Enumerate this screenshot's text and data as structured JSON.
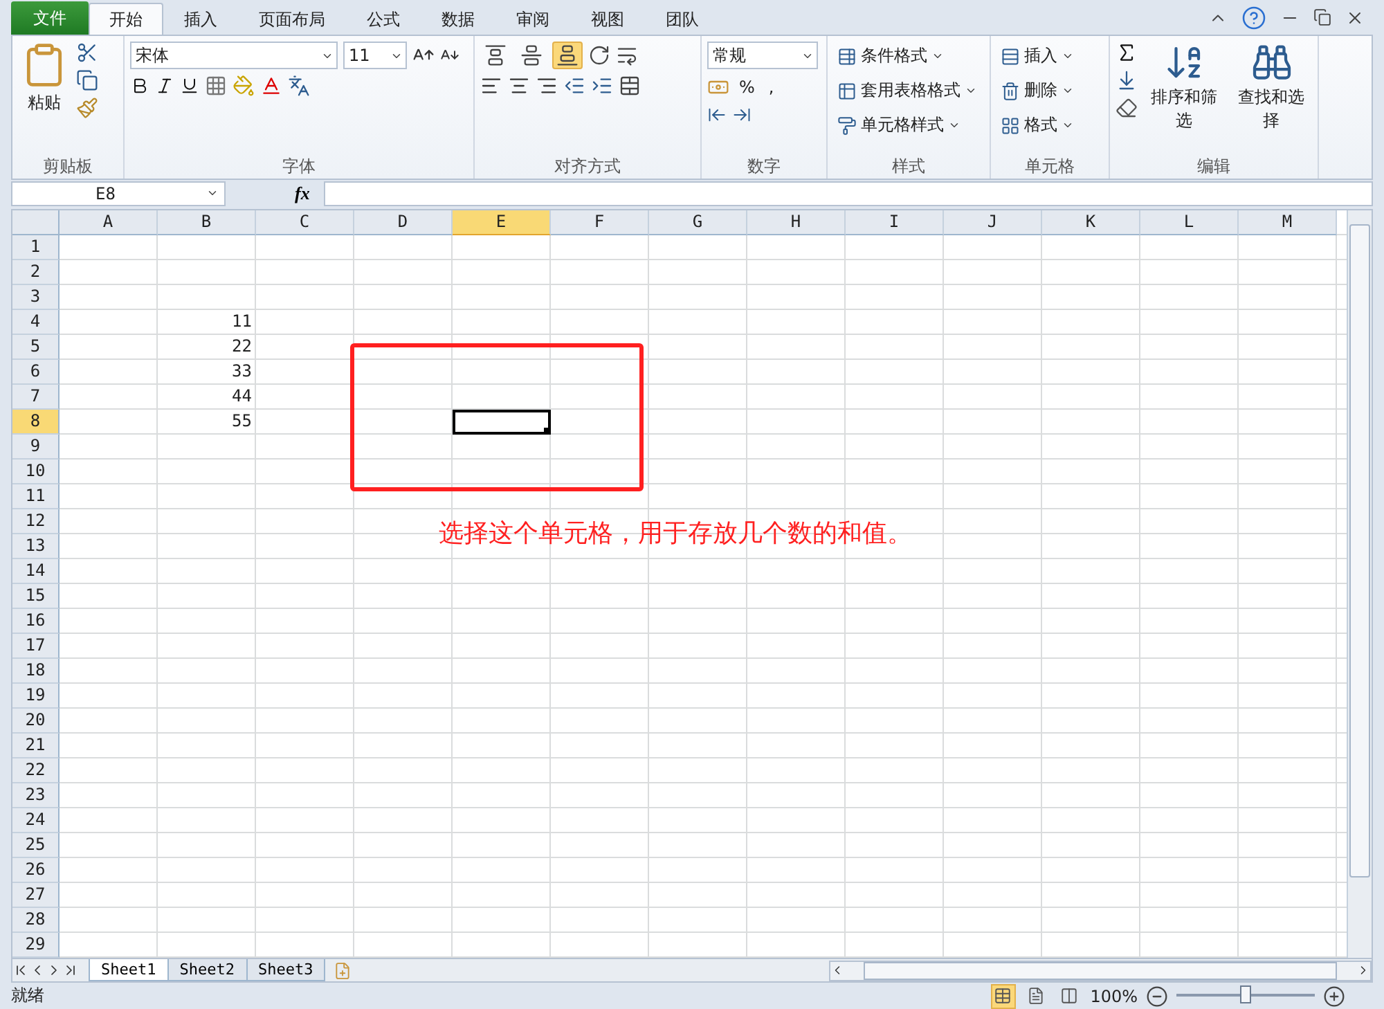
{
  "file_tab": "文件",
  "tabs": [
    {
      "label": "开始",
      "selected": true
    },
    {
      "label": "插入",
      "selected": false
    },
    {
      "label": "页面布局",
      "selected": false
    },
    {
      "label": "公式",
      "selected": false
    },
    {
      "label": "数据",
      "selected": false
    },
    {
      "label": "审阅",
      "selected": false
    },
    {
      "label": "视图",
      "selected": false
    },
    {
      "label": "团队",
      "selected": false
    }
  ],
  "ribbon": {
    "clipboard": {
      "paste": "粘贴",
      "title": "剪贴板"
    },
    "font": {
      "name": "宋体",
      "size": "11",
      "title": "字体"
    },
    "alignment": {
      "title": "对齐方式",
      "bottom_align_selected": true
    },
    "number": {
      "format": "常规",
      "percent": "%",
      "comma": ",",
      "title": "数字"
    },
    "styles": {
      "items": [
        "条件格式",
        "套用表格格式",
        "单元格样式"
      ],
      "title": "样式"
    },
    "cells": {
      "items": [
        "插入",
        "删除",
        "格式"
      ],
      "title": "单元格"
    },
    "editing": {
      "sort": "排序和筛选",
      "find": "查找和选择",
      "title": "编辑"
    }
  },
  "formula_bar": {
    "name_box": "E8",
    "fx": "fx"
  },
  "columns": [
    {
      "label": "A",
      "selected": false
    },
    {
      "label": "B",
      "selected": false
    },
    {
      "label": "C",
      "selected": false
    },
    {
      "label": "D",
      "selected": false
    },
    {
      "label": "E",
      "selected": true
    },
    {
      "label": "F",
      "selected": false
    },
    {
      "label": "G",
      "selected": false
    },
    {
      "label": "H",
      "selected": false
    },
    {
      "label": "I",
      "selected": false
    },
    {
      "label": "J",
      "selected": false
    },
    {
      "label": "K",
      "selected": false
    },
    {
      "label": "L",
      "selected": false
    },
    {
      "label": "M",
      "selected": false
    }
  ],
  "rows": [
    {
      "label": "1",
      "selected": false
    },
    {
      "label": "2",
      "selected": false
    },
    {
      "label": "3",
      "selected": false
    },
    {
      "label": "4",
      "selected": false,
      "b": "11"
    },
    {
      "label": "5",
      "selected": false,
      "b": "22"
    },
    {
      "label": "6",
      "selected": false,
      "b": "33"
    },
    {
      "label": "7",
      "selected": false,
      "b": "44"
    },
    {
      "label": "8",
      "selected": true,
      "b": "55"
    },
    {
      "label": "9",
      "selected": false
    },
    {
      "label": "10",
      "selected": false
    },
    {
      "label": "11",
      "selected": false
    },
    {
      "label": "12",
      "selected": false
    },
    {
      "label": "13",
      "selected": false
    },
    {
      "label": "14",
      "selected": false
    },
    {
      "label": "15",
      "selected": false
    },
    {
      "label": "16",
      "selected": false
    },
    {
      "label": "17",
      "selected": false
    },
    {
      "label": "18",
      "selected": false
    },
    {
      "label": "19",
      "selected": false
    },
    {
      "label": "20",
      "selected": false
    },
    {
      "label": "21",
      "selected": false
    },
    {
      "label": "22",
      "selected": false
    },
    {
      "label": "23",
      "selected": false
    },
    {
      "label": "24",
      "selected": false
    },
    {
      "label": "25",
      "selected": false
    },
    {
      "label": "26",
      "selected": false
    },
    {
      "label": "27",
      "selected": false
    },
    {
      "label": "28",
      "selected": false
    },
    {
      "label": "29",
      "selected": false
    }
  ],
  "annotation": {
    "text": "选择这个单元格，用于存放几个数的和值。"
  },
  "sheet_tabs": [
    {
      "label": "Sheet1",
      "selected": true
    },
    {
      "label": "Sheet2",
      "selected": false
    },
    {
      "label": "Sheet3",
      "selected": false
    }
  ],
  "status_bar": {
    "ready": "就绪",
    "views": [
      {
        "kind": "normal",
        "selected": true
      },
      {
        "kind": "layout",
        "selected": false
      },
      {
        "kind": "pagebreak",
        "selected": false
      }
    ],
    "zoom": "100%",
    "zoom_slider": {
      "level": 0.5
    }
  }
}
